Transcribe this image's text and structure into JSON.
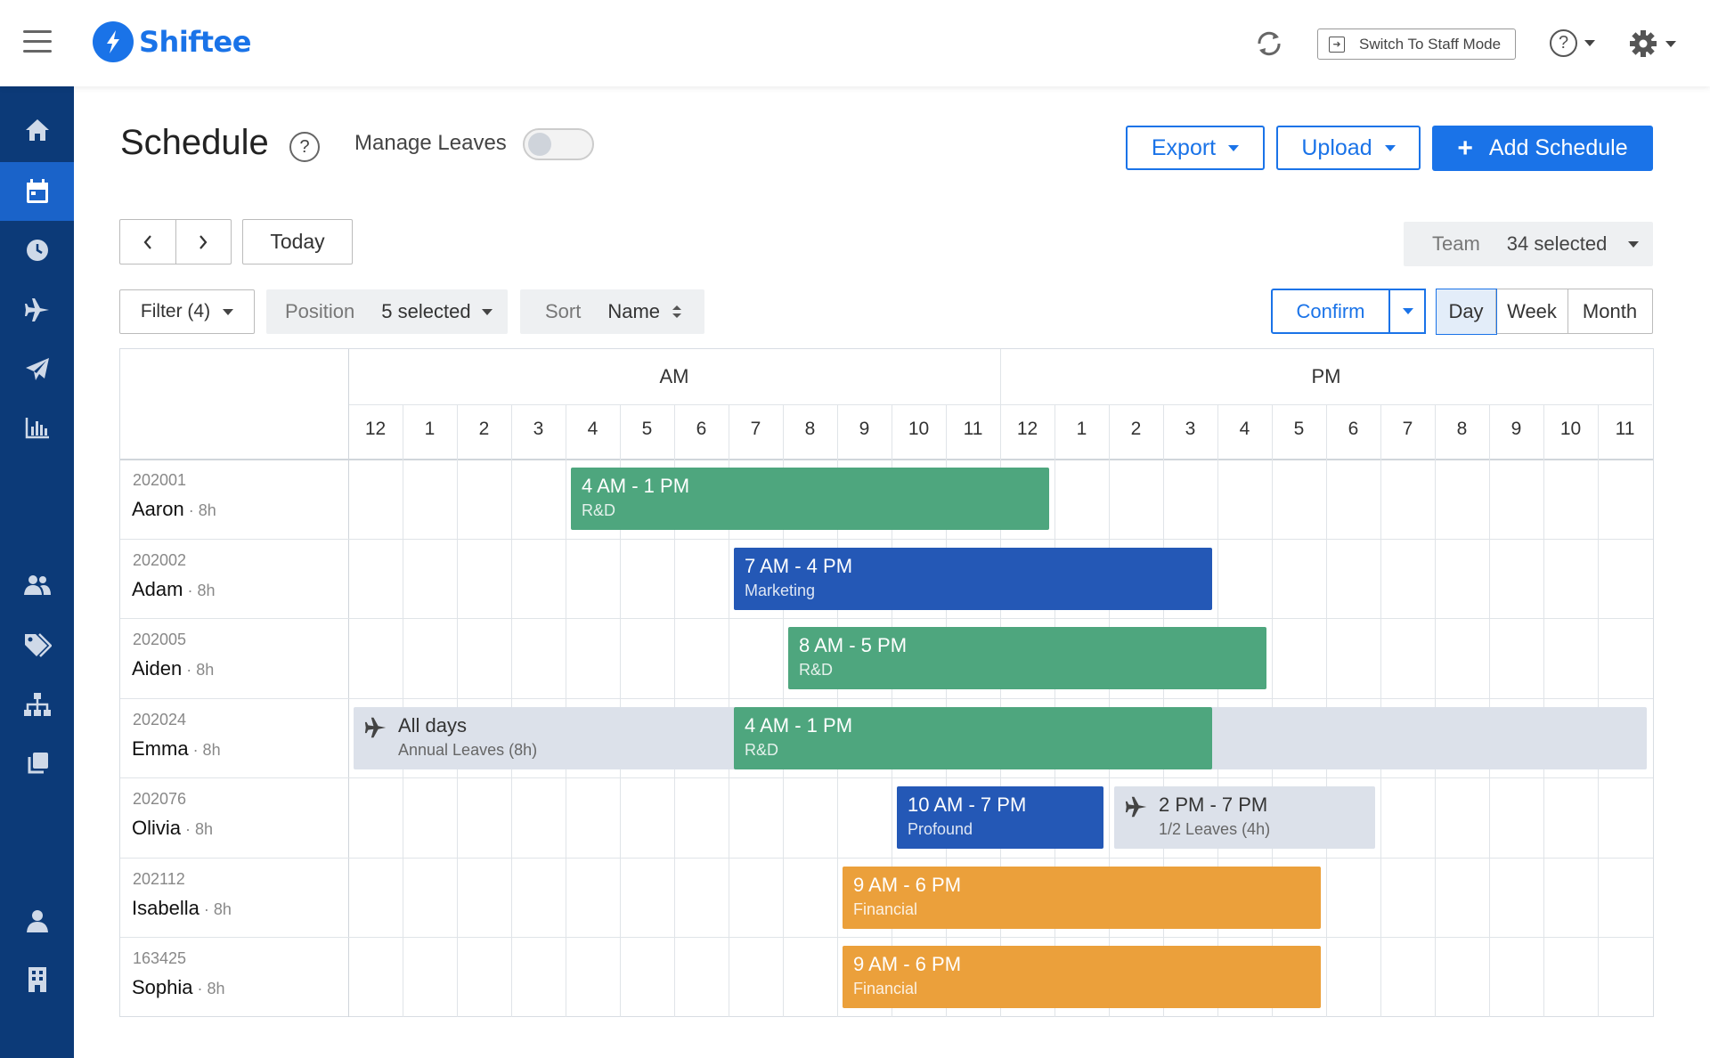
{
  "app": {
    "name": "Shiftee"
  },
  "topbar": {
    "staff_mode_label": "Switch To Staff Mode"
  },
  "header": {
    "title": "Schedule",
    "help": "?",
    "manage_leaves_label": "Manage Leaves",
    "manage_leaves_on": false,
    "export_label": "Export",
    "upload_label": "Upload",
    "add_label": "Add Schedule"
  },
  "nav": {
    "today_label": "Today"
  },
  "team": {
    "label": "Team",
    "value": "34 selected"
  },
  "filters": {
    "filter_label": "Filter (4)",
    "position_label": "Position",
    "position_value": "5 selected",
    "sort_label": "Sort",
    "sort_value": "Name"
  },
  "confirm_label": "Confirm",
  "views": [
    "Day",
    "Week",
    "Month"
  ],
  "selected_view": "Day",
  "timeline": {
    "am": "AM",
    "pm": "PM",
    "hours": [
      "12",
      "1",
      "2",
      "3",
      "4",
      "5",
      "6",
      "7",
      "8",
      "9",
      "10",
      "11",
      "12",
      "1",
      "2",
      "3",
      "4",
      "5",
      "6",
      "7",
      "8",
      "9",
      "10",
      "11"
    ]
  },
  "employees": [
    {
      "id": "202001",
      "name": "Aaron",
      "hours": "8h"
    },
    {
      "id": "202002",
      "name": "Adam",
      "hours": "8h"
    },
    {
      "id": "202005",
      "name": "Aiden",
      "hours": "8h"
    },
    {
      "id": "202024",
      "name": "Emma",
      "hours": "8h"
    },
    {
      "id": "202076",
      "name": "Olivia",
      "hours": "8h"
    },
    {
      "id": "202112",
      "name": "Isabella",
      "hours": "8h"
    },
    {
      "id": "163425",
      "name": "Sophia",
      "hours": "8h"
    }
  ],
  "shifts": [
    {
      "row": 0,
      "start": 4,
      "end": 13,
      "time": "4 AM  - 1 PM",
      "label": "R&D",
      "color": "#4ea67e"
    },
    {
      "row": 1,
      "start": 7,
      "end": 16,
      "time": "7 AM  - 4 PM",
      "label": "Marketing",
      "color": "#2458b6"
    },
    {
      "row": 2,
      "start": 8,
      "end": 17,
      "time": "8 AM  - 5 PM",
      "label": "R&D",
      "color": "#4ea67e"
    },
    {
      "row": 3,
      "start": 7,
      "end": 16,
      "time": "4 AM  - 1 PM",
      "label": "R&D",
      "color": "#4ea67e"
    },
    {
      "row": 4,
      "start": 10,
      "end": 14,
      "time": "10 AM  - 7 PM",
      "label": "Profound",
      "color": "#2458b6"
    },
    {
      "row": 5,
      "start": 9,
      "end": 18,
      "time": "9 AM  - 6 PM",
      "label": "Financial",
      "color": "#eba03b"
    },
    {
      "row": 6,
      "start": 9,
      "end": 18,
      "time": "9 AM  - 6 PM",
      "label": "Financial",
      "color": "#eba03b"
    }
  ],
  "leaves": [
    {
      "row": 3,
      "start": 0,
      "end": 24,
      "title": "All days",
      "sub": "Annual Leaves (8h)"
    },
    {
      "row": 4,
      "start": 14,
      "end": 19,
      "title": "2 PM - 7 PM",
      "sub": "1/2 Leaves (4h)"
    }
  ]
}
